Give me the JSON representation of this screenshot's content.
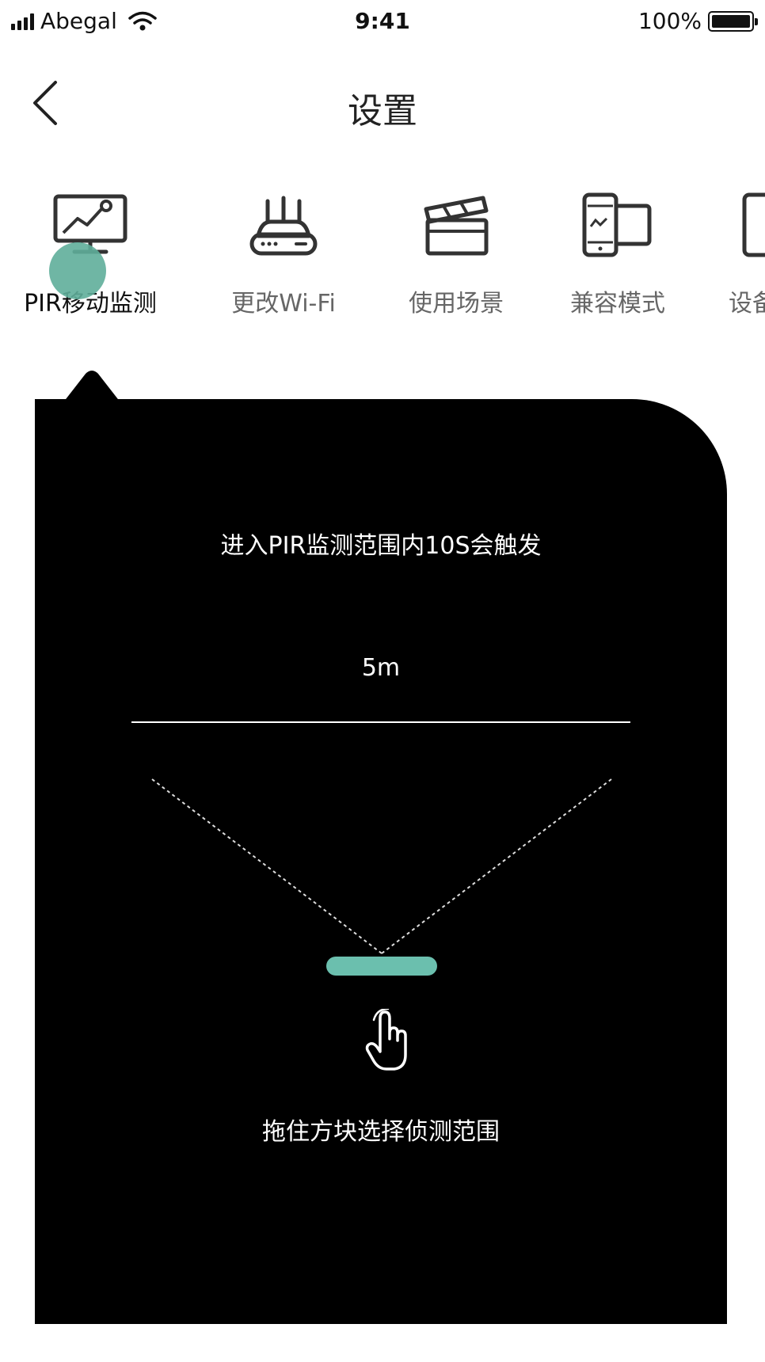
{
  "status_bar": {
    "carrier": "Abegal",
    "time": "9:41",
    "battery": "100%",
    "battery_level": 1.0
  },
  "nav": {
    "title": "设置",
    "back_icon": "chevron-left-icon"
  },
  "tabs": [
    {
      "label": "PIR移动监测",
      "icon": "monitor-chart-icon",
      "active": true
    },
    {
      "label": "更改Wi-Fi",
      "icon": "router-icon",
      "active": false
    },
    {
      "label": "使用场景",
      "icon": "clapperboard-icon",
      "active": false
    },
    {
      "label": "兼容模式",
      "icon": "devices-icon",
      "active": false
    },
    {
      "label": "设备",
      "icon": "device-icon",
      "active": false
    }
  ],
  "panel": {
    "hint_top": "进入PIR监测范围内10S会触发",
    "range_value": "5m",
    "hint_bottom": "拖住方块选择侦测范围",
    "sensor_color": "#6bbfae",
    "touch_color": "#5fae9a",
    "background": "#000000"
  }
}
